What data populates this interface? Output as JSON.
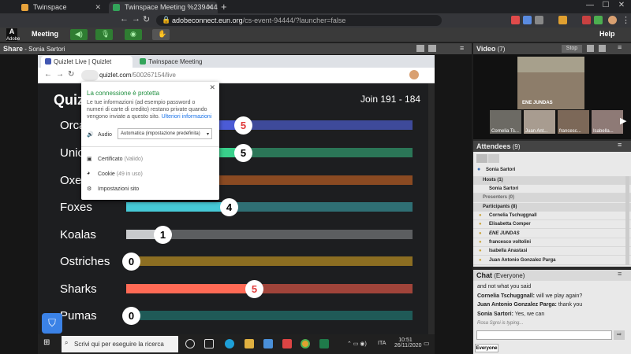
{
  "browser": {
    "tabs": [
      {
        "label": "Twinspace",
        "active": false
      },
      {
        "label": "Twinspace Meeting %2394444",
        "active": true
      }
    ],
    "new_tab": "+",
    "url_domain": "adobeconnect.eun.org",
    "url_path": "/cs-event-94444/?launcher=false",
    "url_prefix": "",
    "window_min": "—",
    "window_max": "☐",
    "window_close": "✕"
  },
  "adobe": {
    "logo": "Adobe",
    "menu": {
      "meeting": "Meeting",
      "help": "Help"
    }
  },
  "share_pod": {
    "title": "Share",
    "presenter": "- Sonia Sartori"
  },
  "inner_browser": {
    "tabs": [
      "Quizlet Live | Quizlet",
      "Twinspace Meeting %2394444"
    ],
    "url_domain": "quizlet.com",
    "url_path": "/500267154/live"
  },
  "quizlet": {
    "logo": "Quizlet",
    "join_text": "Join 191 - 184",
    "teams": [
      {
        "name": "Orcas",
        "score": "5",
        "color": "#4b5bd6",
        "fill": 0.41,
        "red": true
      },
      {
        "name": "Unicorns",
        "score": "5",
        "color": "#39d08b",
        "fill": 0.41,
        "red": false
      },
      {
        "name": "Oxen",
        "score": "",
        "color": "#b8551f",
        "fill": 0.2,
        "red": false
      },
      {
        "name": "Foxes",
        "score": "4",
        "color": "#46c9d6",
        "fill": 0.36,
        "red": false
      },
      {
        "name": "Koalas",
        "score": "1",
        "color": "#c8cacc",
        "fill": 0.13,
        "red": false
      },
      {
        "name": "Ostriches",
        "score": "0",
        "color": "#f0b428",
        "fill": 0.02,
        "red": false
      },
      {
        "name": "Sharks",
        "score": "5",
        "color": "#ff6a55",
        "fill": 0.45,
        "red": true
      },
      {
        "name": "Pumas",
        "score": "0",
        "color": "#2a8f8a",
        "fill": 0.02,
        "red": false
      }
    ],
    "track_colors": [
      "#3e4a9a",
      "#2b7657",
      "#8a4a22",
      "#2f6f74",
      "#5c5e60",
      "#8c6e22",
      "#a0443a",
      "#1f5a57"
    ]
  },
  "security_popup": {
    "title": "La connessione è protetta",
    "body": "Le tue informazioni (ad esempio password o numeri di carte di credito) restano private quando vengono inviate a questo sito.",
    "link": "Ulteriori informazioni",
    "audio_label": "Audio",
    "audio_value": "Automatica (impostazione predefinita)",
    "certificate": "Certificato",
    "certificate_status": "(Valido)",
    "cookies": "Cookie",
    "cookies_count": "(49 in uso)",
    "settings": "Impostazioni sito"
  },
  "taskbar": {
    "search_placeholder": "Scrivi qui per eseguire la ricerca",
    "lang": "ITA",
    "time": "10:51",
    "date": "26/11/2020"
  },
  "video_pod": {
    "title": "Video",
    "count": "(7)",
    "stop_label": "Stop",
    "main_name": "ENE JUNDAS",
    "thumbs": [
      "Cornelia Ts...",
      "Juan Ant...",
      "francesc...",
      "Isabella..."
    ]
  },
  "attendees": {
    "title": "Attendees",
    "count": "(9)",
    "current_user": "Sonia Sartori",
    "sections": {
      "hosts": "Hosts (1)",
      "presenters": "Presenters (0)",
      "participants": "Participants (8)"
    },
    "hosts": [
      "Sonia Sartori"
    ],
    "participants": [
      "Cornelia Tschuggnall",
      "Elisabetta Comper",
      "ENE JUNDAS",
      "francesco voltolini",
      "Isabella Anastasi",
      "Juan Antonio Gonzalez Parga"
    ]
  },
  "chat": {
    "title": "Chat",
    "scope": "(Everyone)",
    "messages": [
      {
        "sender": "",
        "text": "and not what you said"
      },
      {
        "sender": "Cornelia Tschuggnall:",
        "text": " will we play again?"
      },
      {
        "sender": "Juan Antonio Gonzalez Parga:",
        "text": " thank you"
      },
      {
        "sender": "Sonia Sartori:",
        "text": " Yes, we can"
      }
    ],
    "typing": "Rosa Sgroi is typing...",
    "recipient_tab": "Everyone"
  },
  "colors": {
    "adobe_bar": "#3a3a3a",
    "quiz_bg": "#1d1e20",
    "popup_link": "#1a73e8"
  }
}
